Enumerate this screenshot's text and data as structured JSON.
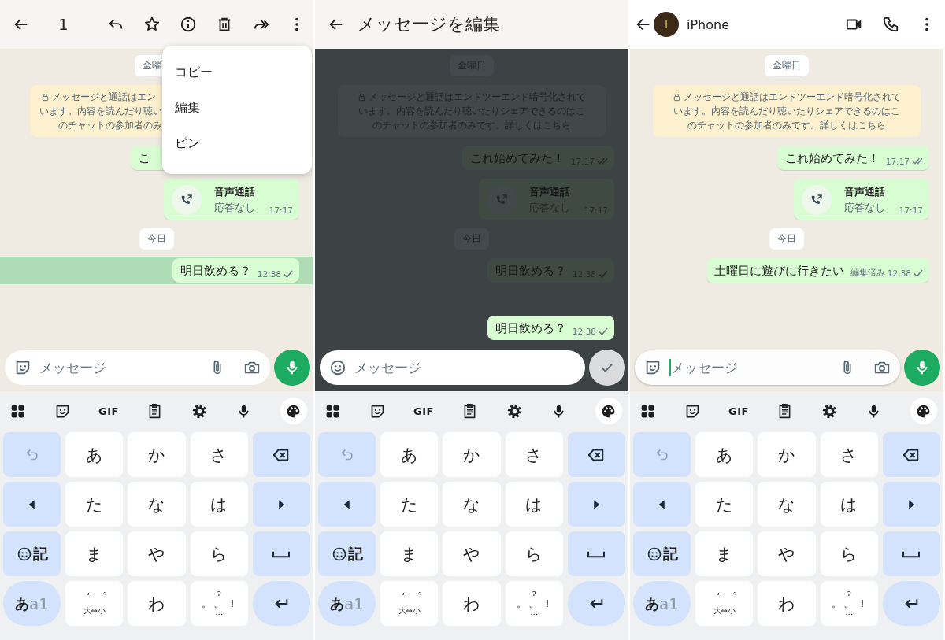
{
  "panels": [
    {
      "kind": "selection",
      "dimmed": false,
      "header": {
        "count": "1"
      },
      "menu": [
        {
          "label": "コピー"
        },
        {
          "label": "編集"
        },
        {
          "label": "ピン"
        }
      ],
      "chat": [
        {
          "kind": "date",
          "text": "金曜",
          "covered": true
        },
        {
          "kind": "notice",
          "covered": true,
          "lines": [
            "メッセージと通話はエン",
            "います。内容を読んだり聴い",
            "のチャットの参加者のみ"
          ]
        },
        {
          "kind": "message",
          "covered": true,
          "selected": false,
          "text": "こ"
        },
        {
          "kind": "call",
          "title": "音声通話",
          "subtitle": "応答なし",
          "time": "17:17"
        },
        {
          "kind": "date",
          "text": "今日",
          "covered": false
        },
        {
          "kind": "message",
          "covered": false,
          "selected": true,
          "text": "明日飲める？",
          "time": "12:38",
          "delivered": false
        }
      ],
      "composer": {
        "kind": "normal",
        "placeholder": "メッセージ",
        "focused": false
      },
      "keyboard": {
        "gif_label": "GIF",
        "keys": [
          {
            "kind": "undo"
          },
          {
            "kind": "char",
            "label": "あ"
          },
          {
            "kind": "char",
            "label": "か"
          },
          {
            "kind": "char",
            "label": "さ"
          },
          {
            "kind": "backspace"
          },
          {
            "kind": "left"
          },
          {
            "kind": "char",
            "label": "た"
          },
          {
            "kind": "char",
            "label": "な"
          },
          {
            "kind": "char",
            "label": "は"
          },
          {
            "kind": "right"
          },
          {
            "kind": "emoji-symbol",
            "label": "記"
          },
          {
            "kind": "char",
            "label": "ま"
          },
          {
            "kind": "char",
            "label": "や"
          },
          {
            "kind": "char",
            "label": "ら"
          },
          {
            "kind": "space"
          },
          {
            "kind": "mode",
            "label": "あ",
            "sublabel": "a1"
          },
          {
            "kind": "small",
            "lines": [
              "゛゜",
              "大⇔小"
            ]
          },
          {
            "kind": "char",
            "label": "わ"
          },
          {
            "kind": "small",
            "lines": [
              "?",
              "。、 !",
              "…"
            ]
          },
          {
            "kind": "enter"
          }
        ]
      }
    },
    {
      "kind": "edit",
      "dimmed": true,
      "header": {
        "title": "メッセージを編集"
      },
      "chat": [
        {
          "kind": "date",
          "text": "金曜日"
        },
        {
          "kind": "notice",
          "lines": [
            "メッセージと通話はエンドツーエンド暗号化されて",
            "います。内容を読んだり聴いたりシェアできるのはこ",
            "のチャットの参加者のみです。詳しくはこちら"
          ]
        },
        {
          "kind": "message",
          "text": "これ始めてみた！",
          "time": "17:17",
          "delivered": true
        },
        {
          "kind": "call",
          "title": "音声通話",
          "subtitle": "応答なし",
          "time": "17:17"
        },
        {
          "kind": "date",
          "text": "今日"
        },
        {
          "kind": "message",
          "text": "明日飲める？",
          "time": "12:38",
          "delivered": false
        }
      ],
      "edit_preview": {
        "text": "明日飲める？",
        "time": "12:38",
        "delivered": false
      },
      "composer": {
        "kind": "edit",
        "placeholder": "メッセージ",
        "focused": false
      },
      "keyboard": {
        "gif_label": "GIF",
        "keys": [
          {
            "kind": "undo"
          },
          {
            "kind": "char",
            "label": "あ"
          },
          {
            "kind": "char",
            "label": "か"
          },
          {
            "kind": "char",
            "label": "さ"
          },
          {
            "kind": "backspace"
          },
          {
            "kind": "left"
          },
          {
            "kind": "char",
            "label": "た"
          },
          {
            "kind": "char",
            "label": "な"
          },
          {
            "kind": "char",
            "label": "は"
          },
          {
            "kind": "right"
          },
          {
            "kind": "emoji-symbol",
            "label": "記"
          },
          {
            "kind": "char",
            "label": "ま"
          },
          {
            "kind": "char",
            "label": "や"
          },
          {
            "kind": "char",
            "label": "ら"
          },
          {
            "kind": "space"
          },
          {
            "kind": "mode",
            "label": "あ",
            "sublabel": "a1"
          },
          {
            "kind": "small",
            "lines": [
              "゛゜",
              "大⇔小"
            ]
          },
          {
            "kind": "char",
            "label": "わ"
          },
          {
            "kind": "small",
            "lines": [
              "?",
              "。、 !",
              "…"
            ]
          },
          {
            "kind": "enter"
          }
        ]
      }
    },
    {
      "kind": "chat",
      "dimmed": false,
      "header": {
        "avatar_initial": "I",
        "name": "iPhone"
      },
      "chat": [
        {
          "kind": "date",
          "text": "金曜日"
        },
        {
          "kind": "notice",
          "lines": [
            "メッセージと通話はエンドツーエンド暗号化されて",
            "います。内容を読んだり聴いたりシェアできるのはこ",
            "のチャットの参加者のみです。詳しくはこちら"
          ]
        },
        {
          "kind": "message",
          "text": "これ始めてみた！",
          "time": "17:17",
          "delivered": true
        },
        {
          "kind": "call",
          "title": "音声通話",
          "subtitle": "応答なし",
          "time": "17:17"
        },
        {
          "kind": "date",
          "text": "今日"
        },
        {
          "kind": "message",
          "text": "土曜日に遊びに行きたい",
          "edited": "編集済み",
          "time": "12:38",
          "delivered": false
        }
      ],
      "composer": {
        "kind": "normal",
        "placeholder": "メッセージ",
        "focused": true
      },
      "keyboard": {
        "gif_label": "GIF",
        "keys": [
          {
            "kind": "undo"
          },
          {
            "kind": "char",
            "label": "あ"
          },
          {
            "kind": "char",
            "label": "か"
          },
          {
            "kind": "char",
            "label": "さ"
          },
          {
            "kind": "backspace"
          },
          {
            "kind": "left"
          },
          {
            "kind": "char",
            "label": "た"
          },
          {
            "kind": "char",
            "label": "な"
          },
          {
            "kind": "char",
            "label": "は"
          },
          {
            "kind": "right"
          },
          {
            "kind": "emoji-symbol",
            "label": "記"
          },
          {
            "kind": "char",
            "label": "ま"
          },
          {
            "kind": "char",
            "label": "や"
          },
          {
            "kind": "char",
            "label": "ら"
          },
          {
            "kind": "space"
          },
          {
            "kind": "mode",
            "label": "あ",
            "sublabel": "a1"
          },
          {
            "kind": "small",
            "lines": [
              "゛゜",
              "大⇔小"
            ]
          },
          {
            "kind": "char",
            "label": "わ"
          },
          {
            "kind": "small",
            "lines": [
              "?",
              "。、 !",
              "…"
            ]
          },
          {
            "kind": "enter"
          }
        ]
      }
    }
  ]
}
